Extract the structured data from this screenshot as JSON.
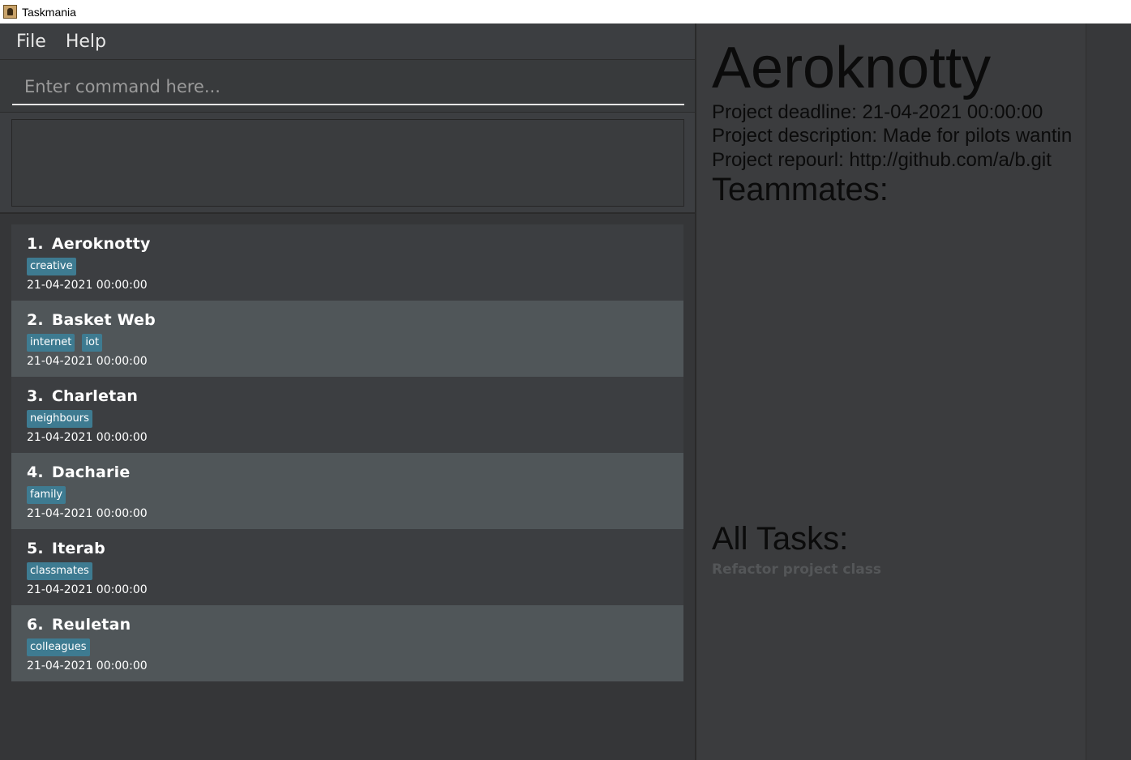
{
  "window": {
    "title": "Taskmania"
  },
  "menu": {
    "items": [
      {
        "label": "File"
      },
      {
        "label": "Help"
      }
    ]
  },
  "command": {
    "placeholder": "Enter command here...",
    "value": ""
  },
  "result": {
    "text": ""
  },
  "projects": [
    {
      "index": "1.",
      "name": "Aeroknotty",
      "tags": [
        "creative"
      ],
      "deadline": "21-04-2021 00:00:00"
    },
    {
      "index": "2.",
      "name": "Basket Web",
      "tags": [
        "internet",
        "iot"
      ],
      "deadline": "21-04-2021 00:00:00"
    },
    {
      "index": "3.",
      "name": "Charletan",
      "tags": [
        "neighbours"
      ],
      "deadline": "21-04-2021 00:00:00"
    },
    {
      "index": "4.",
      "name": "Dacharie",
      "tags": [
        "family"
      ],
      "deadline": "21-04-2021 00:00:00"
    },
    {
      "index": "5.",
      "name": "Iterab",
      "tags": [
        "classmates"
      ],
      "deadline": "21-04-2021 00:00:00"
    },
    {
      "index": "6.",
      "name": "Reuletan",
      "tags": [
        "colleagues"
      ],
      "deadline": "21-04-2021 00:00:00"
    }
  ],
  "detail": {
    "title": "Aeroknotty",
    "deadline_line": "Project deadline: 21-04-2021 00:00:00",
    "description_line": "Project description: Made for pilots wantin",
    "repo_line": "Project repourl: http://github.com/a/b.git",
    "teammates_heading": "Teammates:",
    "tasks_heading": "All Tasks:",
    "tasks": [
      "Refactor project class"
    ]
  },
  "colors": {
    "tag": "#3e7b91",
    "card_odd": "#3c3e41",
    "card_even": "#505659",
    "panel": "#3b3c3e"
  }
}
